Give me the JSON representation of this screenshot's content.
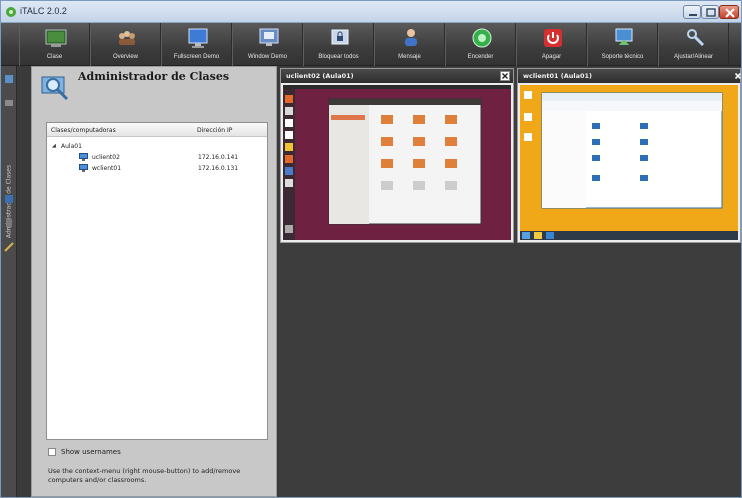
{
  "window": {
    "title": "iTALC 2.0.2"
  },
  "toolbar": {
    "buttons": [
      {
        "label": "Clase",
        "icon": "classroom-icon"
      },
      {
        "label": "Overview",
        "icon": "overview-icon"
      },
      {
        "label": "Fullscreen Demo",
        "icon": "fullscreen-demo-icon"
      },
      {
        "label": "Window Demo",
        "icon": "window-demo-icon"
      },
      {
        "label": "Bloquear todos",
        "icon": "lock-icon"
      },
      {
        "label": "Mensaje",
        "icon": "message-icon"
      },
      {
        "label": "Encender",
        "icon": "power-on-icon"
      },
      {
        "label": "Apagar",
        "icon": "power-off-icon"
      },
      {
        "label": "Soporte técnico",
        "icon": "remote-support-icon"
      },
      {
        "label": "Ajustar/Alinear",
        "icon": "adjust-icon"
      }
    ]
  },
  "sidebar": {
    "vertical_label": "Administrador de Clases"
  },
  "panel": {
    "title": "Administrador de Clases",
    "columns": [
      "Clases/computadoras",
      "Dirección IP"
    ],
    "tree": {
      "group": "Aula01",
      "computers": [
        {
          "name": "uclient02",
          "ip": "172.16.0.141"
        },
        {
          "name": "wclient01",
          "ip": "172.16.0.131"
        }
      ]
    },
    "show_usernames_label": "Show usernames",
    "hint": "Use the context-menu (right mouse-button) to add/remove computers and/or classrooms."
  },
  "tiles": [
    {
      "title": "uclient02 (Aula01)"
    },
    {
      "title": "wclient01 (Aula01)"
    }
  ],
  "colors": {
    "ubuntu_bg": "#6e2140",
    "windows_bg": "#f0a818",
    "toolbar_bg": "#3c3c3c"
  }
}
